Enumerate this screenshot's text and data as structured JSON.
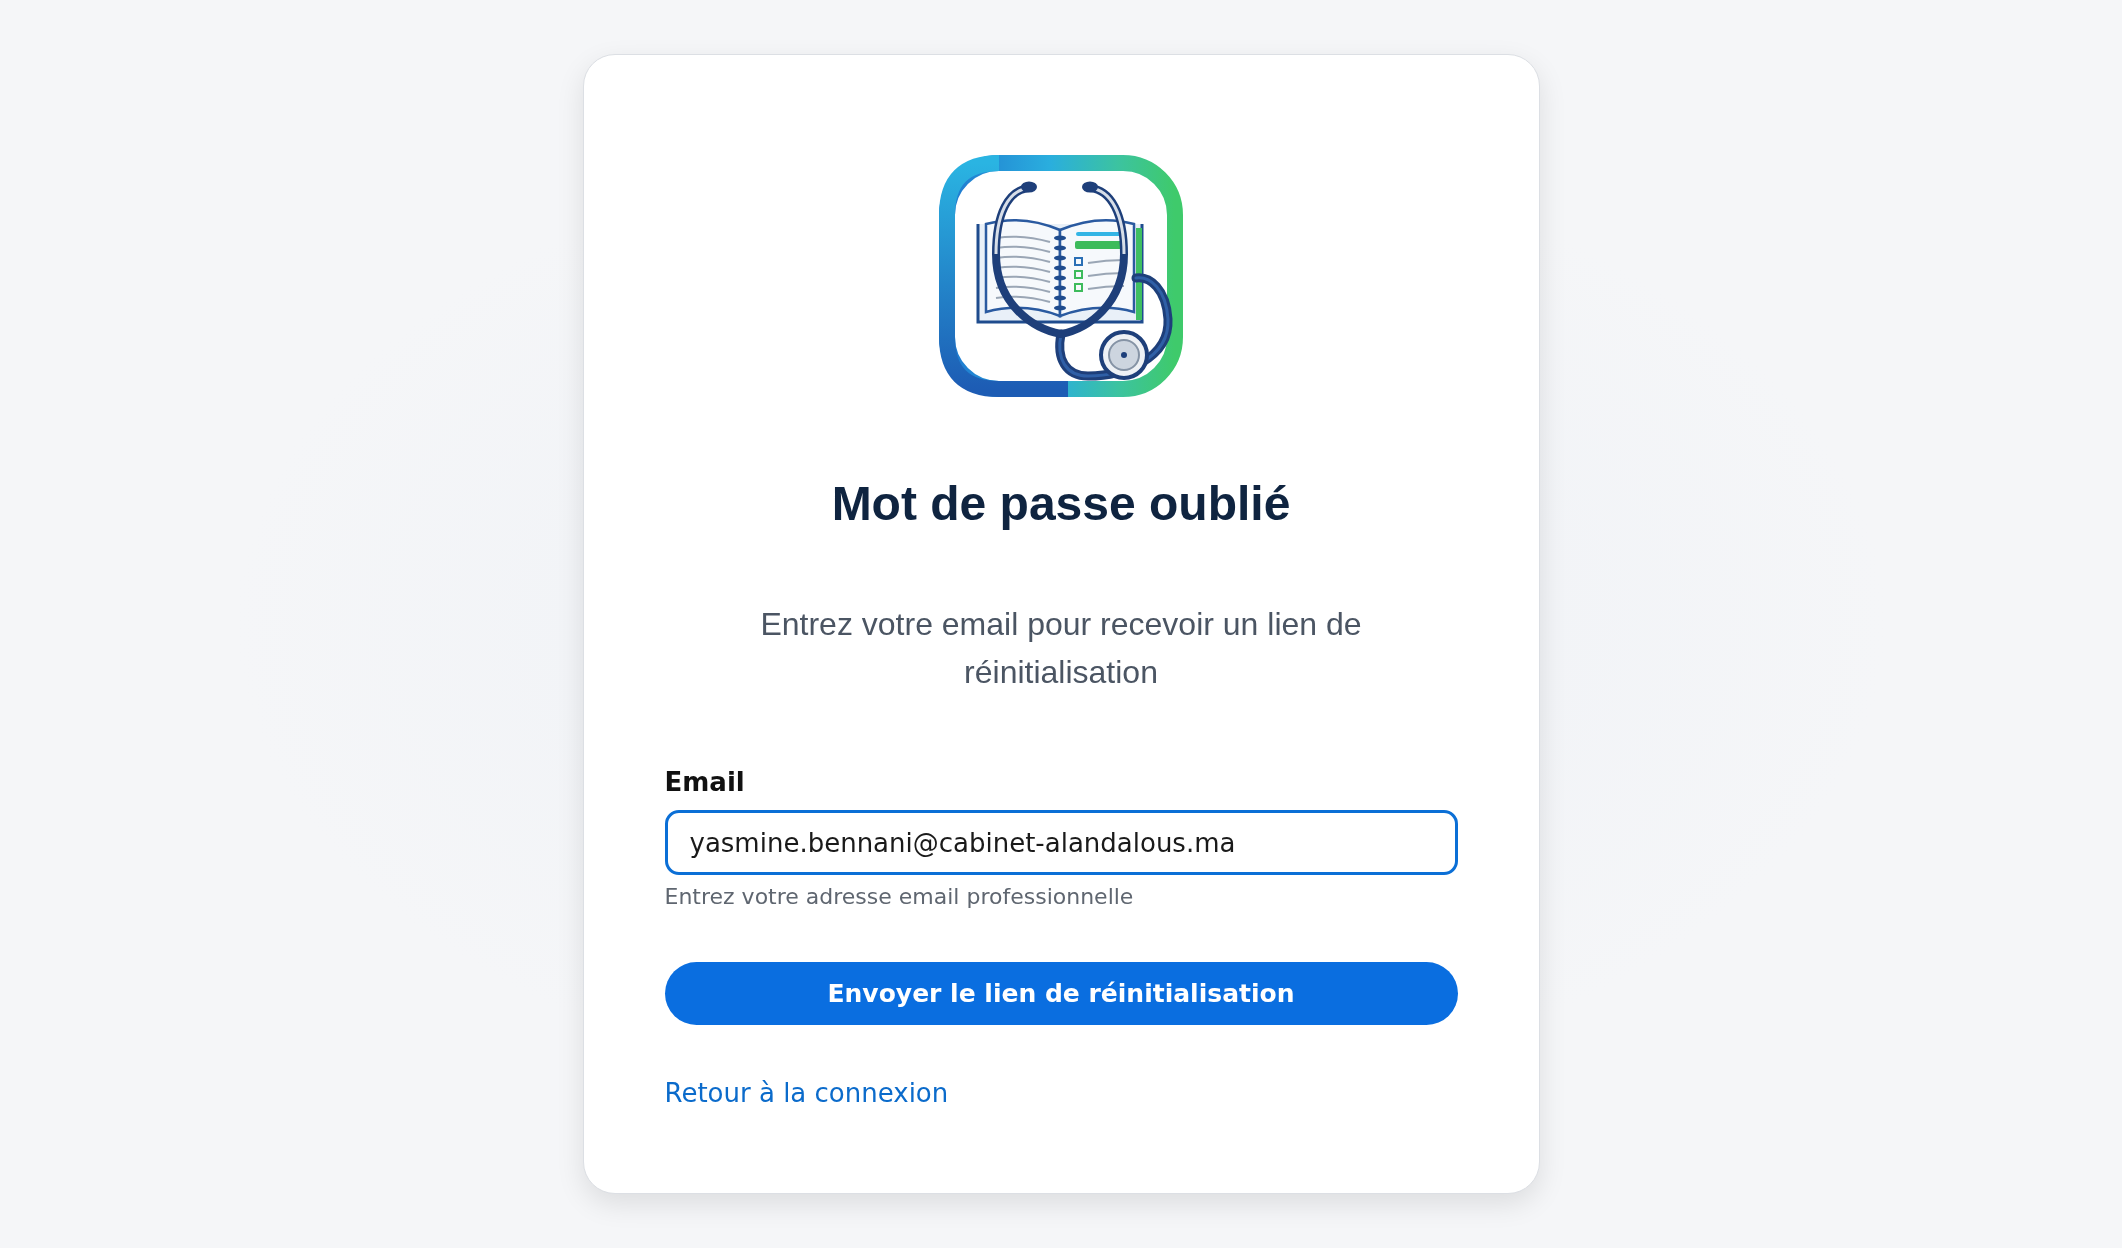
{
  "title": "Mot de passe oublié",
  "subtitle": "Entrez votre email pour recevoir un lien de réinitialisation",
  "email_field": {
    "label": "Email",
    "value": "yasmine.bennani@cabinet-alandalous.ma",
    "helper": "Entrez votre adresse email professionnelle",
    "focused": true
  },
  "submit_button": {
    "label": "Envoyer le lien de réinitialisation"
  },
  "back_link": {
    "label": "Retour à la connexion"
  }
}
